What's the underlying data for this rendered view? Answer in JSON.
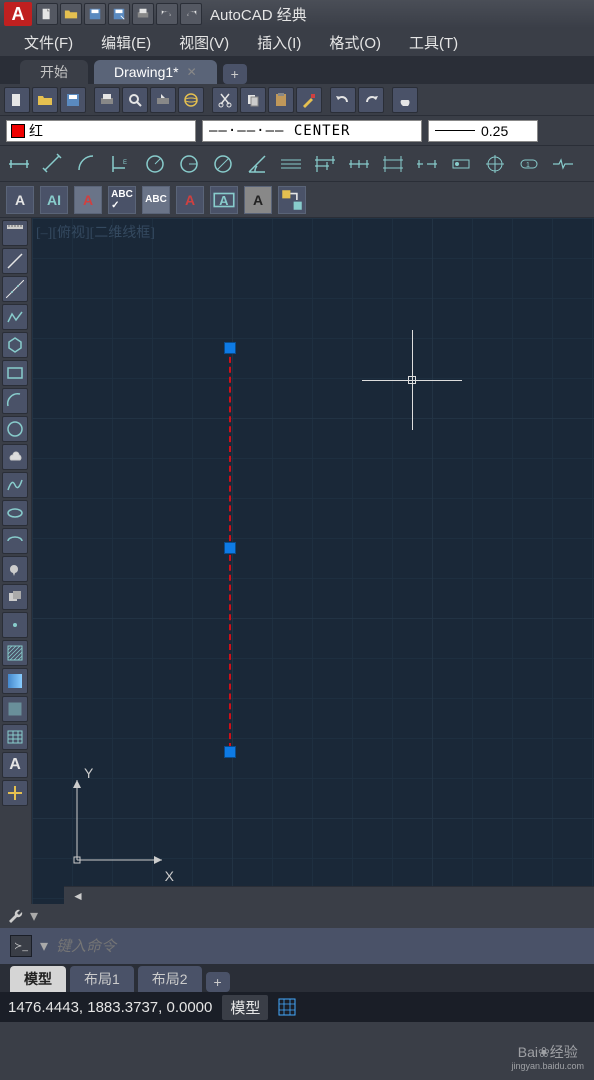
{
  "app": {
    "title": "AutoCAD 经典",
    "logo": "A"
  },
  "menu": {
    "file": "文件(F)",
    "edit": "编辑(E)",
    "view": "视图(V)",
    "insert": "插入(I)",
    "format": "格式(O)",
    "tools": "工具(T)"
  },
  "tabs": {
    "start": "开始",
    "drawing": "Drawing1*"
  },
  "props": {
    "color": "红",
    "linetype": "——·——·—— CENTER",
    "lineweight": "0.25"
  },
  "viewport": {
    "label": "[–][俯视][二维线框]",
    "ucs_x": "X",
    "ucs_y": "Y"
  },
  "cmd": {
    "placeholder": "键入命令"
  },
  "layouts": {
    "model": "模型",
    "layout1": "布局1",
    "layout2": "布局2"
  },
  "status": {
    "coords": "1476.4443, 1883.3737, 0.0000",
    "model": "模型"
  },
  "watermark": {
    "text": "Bai❀经验",
    "url": "jingyan.baidu.com"
  }
}
